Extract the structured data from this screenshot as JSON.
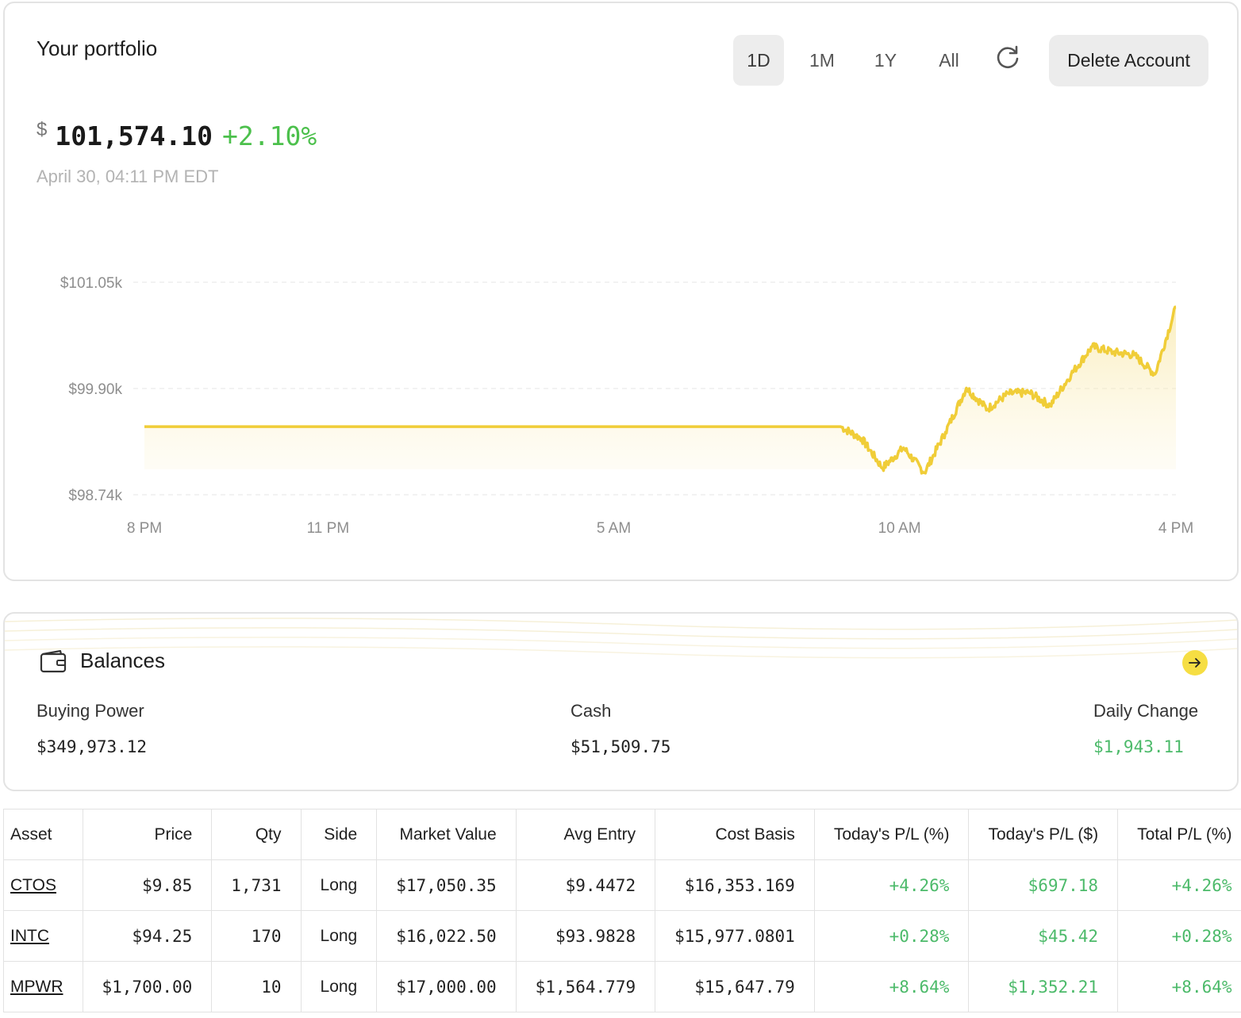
{
  "portfolio": {
    "title": "Your portfolio",
    "ranges": [
      "1D",
      "1M",
      "1Y",
      "All"
    ],
    "active_range": "1D",
    "delete_label": "Delete Account",
    "currency_symbol": "$",
    "total_value": "101,574.10",
    "change_pct": "+2.10%",
    "timestamp": "April 30, 04:11 PM EDT"
  },
  "chart_data": {
    "type": "area",
    "title": "",
    "xlabel": "",
    "ylabel": "",
    "y_tick_labels": [
      "$101.05k",
      "$99.90k",
      "$98.74k"
    ],
    "x_tick_labels": [
      "8 PM",
      "11 PM",
      "5 AM",
      "10 AM",
      "4 PM"
    ],
    "ylim": [
      98740,
      101050
    ],
    "grid": true,
    "line_color": "#f0cd38",
    "series": [
      {
        "x": [
          "8 PM",
          "11 PM",
          "5 AM",
          "9:20 AM",
          "9:30 AM",
          "9:40 AM",
          "9:50 AM",
          "10 AM",
          "10:30 AM",
          "11 AM",
          "11:30 AM",
          "12 PM",
          "12:30 PM",
          "1 PM",
          "1:30 PM",
          "2 PM",
          "2:30 PM",
          "3 PM",
          "3:30 PM",
          "4 PM"
        ],
        "values": [
          99480,
          99480,
          99480,
          99480,
          99350,
          99030,
          99250,
          98980,
          99420,
          99900,
          99670,
          99840,
          99850,
          99710,
          100050,
          100350,
          100290,
          100260,
          100050,
          100780
        ]
      }
    ]
  },
  "balances": {
    "title": "Balances",
    "buying_power_label": "Buying Power",
    "buying_power": "$349,973.12",
    "cash_label": "Cash",
    "cash": "$51,509.75",
    "daily_change_label": "Daily Change",
    "daily_change": "$1,943.11"
  },
  "positions": {
    "headers": [
      "Asset",
      "Price",
      "Qty",
      "Side",
      "Market Value",
      "Avg Entry",
      "Cost Basis",
      "Today's P/L (%)",
      "Today's P/L ($)",
      "Total P/L (%)"
    ],
    "rows": [
      [
        "CTOS",
        "$9.85",
        "1,731",
        "Long",
        "$17,050.35",
        "$9.4472",
        "$16,353.169",
        "+4.26%",
        "$697.18",
        "+4.26%"
      ],
      [
        "INTC",
        "$94.25",
        "170",
        "Long",
        "$16,022.50",
        "$93.9828",
        "$15,977.0801",
        "+0.28%",
        "$45.42",
        "+0.28%"
      ],
      [
        "MPWR",
        "$1,700.00",
        "10",
        "Long",
        "$17,000.00",
        "$1,564.779",
        "$15,647.79",
        "+8.64%",
        "$1,352.21",
        "+8.64%"
      ]
    ]
  }
}
